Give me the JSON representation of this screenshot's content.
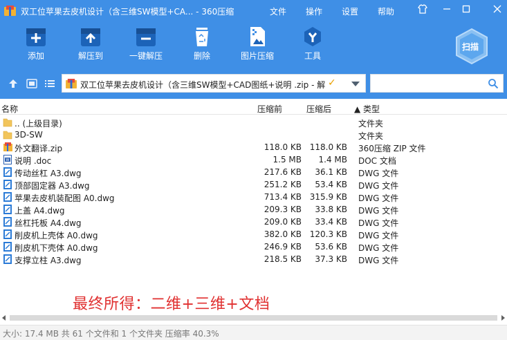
{
  "window": {
    "title": "双工位苹果去皮机设计（含三维SW模型+CA... - 360压缩",
    "menu": [
      "文件",
      "操作",
      "设置",
      "帮助"
    ]
  },
  "toolbar": {
    "tools": [
      {
        "label": "添加",
        "icon": "add-icon"
      },
      {
        "label": "解压到",
        "icon": "extract-to-icon"
      },
      {
        "label": "一键解压",
        "icon": "one-click-extract-icon"
      },
      {
        "label": "删除",
        "icon": "delete-icon"
      },
      {
        "label": "图片压缩",
        "icon": "image-compress-icon"
      },
      {
        "label": "工具",
        "icon": "tools-icon"
      }
    ],
    "scan_label": "扫描"
  },
  "address": {
    "path": "双工位苹果去皮机设计（含三维SW模型+CAD图纸+说明 .zip - 解"
  },
  "columns": {
    "name": "名称",
    "size": "压缩前",
    "packed": "压缩后",
    "type": "▲ 类型"
  },
  "files": [
    {
      "name": ".. (上级目录)",
      "size": "",
      "packed": "",
      "type": "文件夹",
      "icon": "folder-icon"
    },
    {
      "name": "3D-SW",
      "size": "",
      "packed": "",
      "type": "文件夹",
      "icon": "folder-icon"
    },
    {
      "name": "外文翻译.zip",
      "size": "118.0 KB",
      "packed": "118.0 KB",
      "type": "360压缩 ZIP 文件",
      "icon": "zip-icon"
    },
    {
      "name": "说明 .doc",
      "size": "1.5 MB",
      "packed": "1.4 MB",
      "type": "DOC 文档",
      "icon": "doc-icon"
    },
    {
      "name": "传动丝杠 A3.dwg",
      "size": "217.6 KB",
      "packed": "36.1 KB",
      "type": "DWG 文件",
      "icon": "dwg-icon"
    },
    {
      "name": "顶部固定器 A3.dwg",
      "size": "251.2 KB",
      "packed": "53.4 KB",
      "type": "DWG 文件",
      "icon": "dwg-icon"
    },
    {
      "name": "苹果去皮机装配图 A0.dwg",
      "size": "713.4 KB",
      "packed": "315.9 KB",
      "type": "DWG 文件",
      "icon": "dwg-icon"
    },
    {
      "name": "上盖 A4.dwg",
      "size": "209.3 KB",
      "packed": "33.8 KB",
      "type": "DWG 文件",
      "icon": "dwg-icon"
    },
    {
      "name": "丝杠托板 A4.dwg",
      "size": "209.0 KB",
      "packed": "33.4 KB",
      "type": "DWG 文件",
      "icon": "dwg-icon"
    },
    {
      "name": "削皮机上壳体 A0.dwg",
      "size": "382.0 KB",
      "packed": "120.3 KB",
      "type": "DWG 文件",
      "icon": "dwg-icon"
    },
    {
      "name": "削皮机下壳体 A0.dwg",
      "size": "246.9 KB",
      "packed": "53.6 KB",
      "type": "DWG 文件",
      "icon": "dwg-icon"
    },
    {
      "name": "支撑立柱 A3.dwg",
      "size": "218.5 KB",
      "packed": "37.3 KB",
      "type": "DWG 文件",
      "icon": "dwg-icon"
    }
  ],
  "overlay_caption": "最终所得：二维+三维+文档",
  "status": "大小: 17.4 MB 共 61 个文件和 1 个文件夹 压缩率 40.3%",
  "colors": {
    "accent": "#3f8fe6",
    "caption": "#e03030",
    "folder": "#f2c55c",
    "dwg": "#2a7ad6"
  }
}
